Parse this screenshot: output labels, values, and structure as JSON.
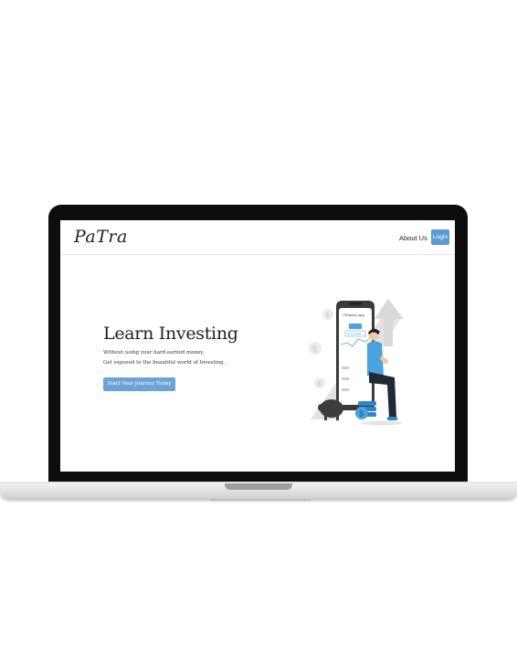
{
  "brand": {
    "logo": "PaTra"
  },
  "nav": {
    "about_label": "About Us",
    "login_label": "Login"
  },
  "hero": {
    "title": "Learn Investing",
    "subtitle_line1": "Without using your hard earned money,",
    "subtitle_line2": "Get exposed to the beautiful world of Investing .",
    "cta_label": "Start Your Journey Today"
  },
  "illustration": {
    "app_header": "Ultimate app",
    "app_value": "$ 23,800",
    "currency_symbol": "$"
  },
  "colors": {
    "accent": "#5b9bd5",
    "cta": "#6ea3d8",
    "laptop_frame": "#0d0d0d"
  }
}
